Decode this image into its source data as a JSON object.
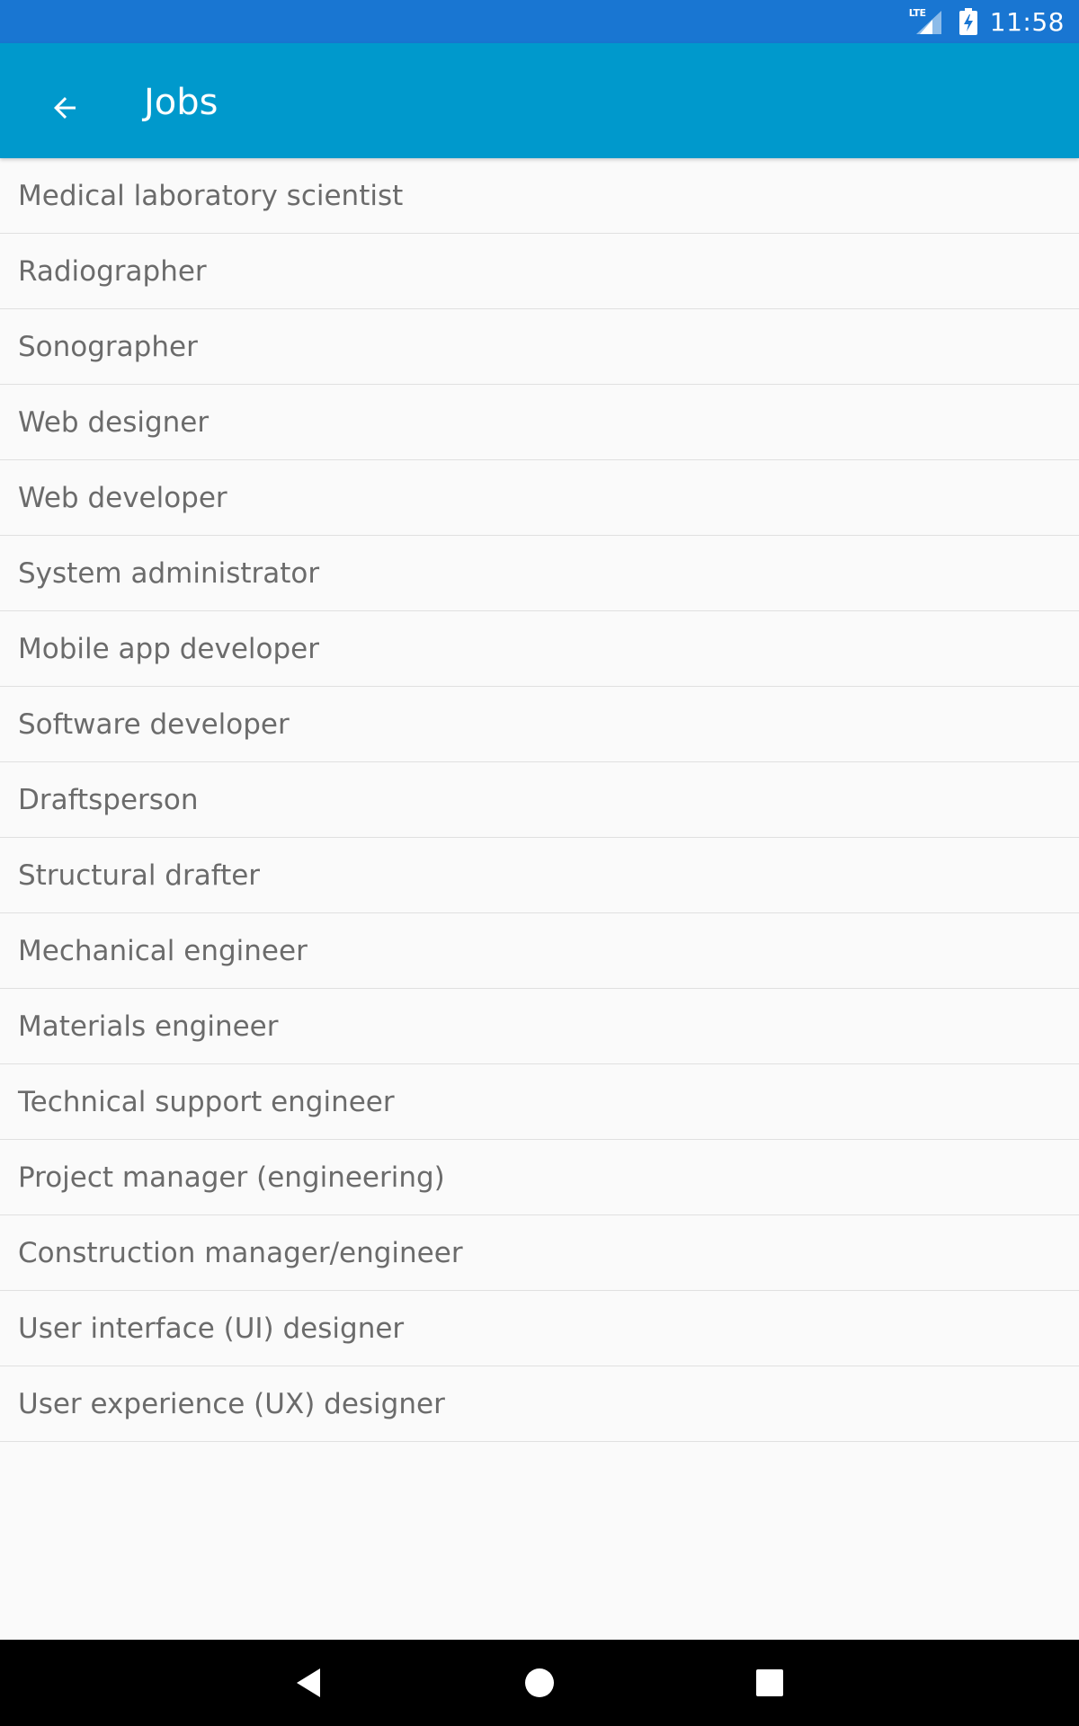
{
  "status_bar": {
    "network": "LTE",
    "time": "11:58",
    "icons": [
      "lte-signal-icon",
      "battery-charging-icon"
    ]
  },
  "app_bar": {
    "title": "Jobs",
    "back_icon": "arrow-back-icon"
  },
  "jobs": [
    "Medical laboratory scientist",
    "Radiographer",
    "Sonographer",
    "Web designer",
    "Web developer",
    "System administrator",
    "Mobile app developer",
    "Software developer",
    "Draftsperson",
    "Structural drafter",
    "Mechanical engineer",
    "Materials engineer",
    "Technical support engineer",
    "Project manager (engineering)",
    "Construction manager/engineer",
    "User interface (UI) designer",
    "User experience (UX) designer"
  ],
  "nav_bar": {
    "icons": [
      "nav-back-icon",
      "nav-home-icon",
      "nav-recents-icon"
    ]
  },
  "colors": {
    "status_bar": "#1976D2",
    "app_bar": "#0099CC",
    "background": "#FAFAFA",
    "list_text": "#6B6B6B",
    "divider": "#E0E0E0",
    "nav_bar": "#000000"
  }
}
